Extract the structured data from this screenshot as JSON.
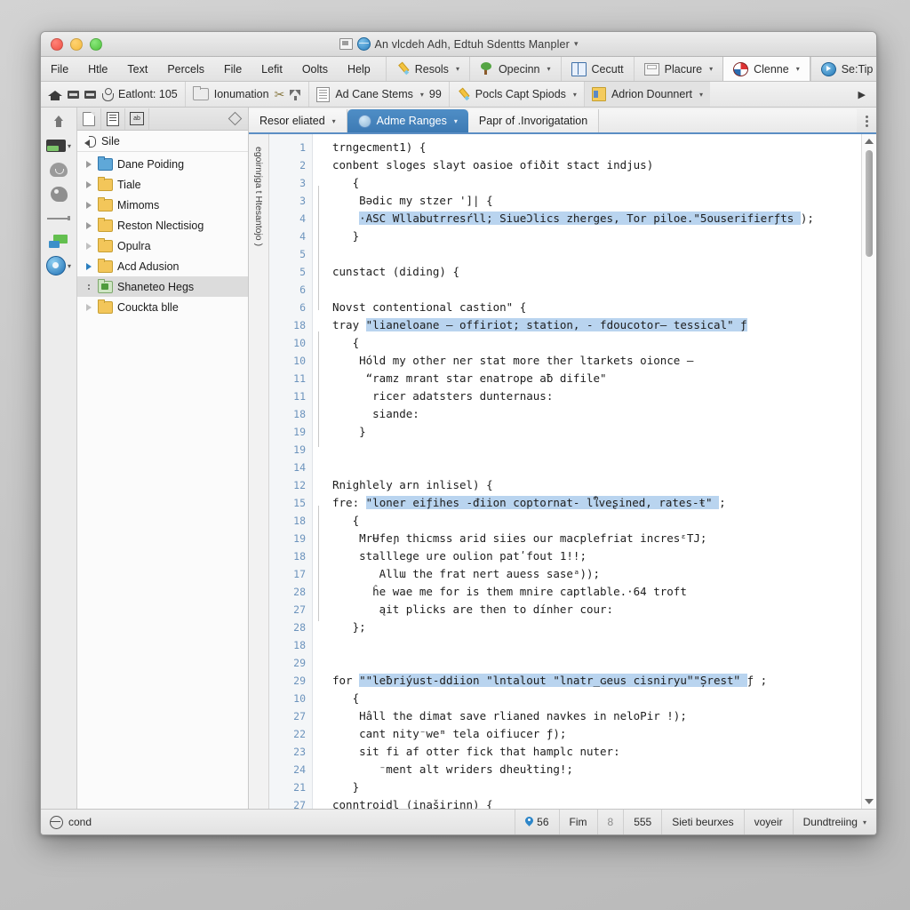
{
  "window": {
    "title": "An vlcdeh Adh, Edtuh Sdentts Manpler",
    "title_caret": "▾",
    "traffic": {
      "close": "close-button",
      "minimize": "minimize-button",
      "zoom": "zoom-button"
    }
  },
  "menubar": {
    "items": [
      {
        "label": "File"
      },
      {
        "label": "Htle"
      },
      {
        "label": "Text"
      },
      {
        "label": "Percels"
      },
      {
        "label": "File"
      },
      {
        "label": "Lefit"
      },
      {
        "label": "Oolts"
      },
      {
        "label": "Help"
      }
    ],
    "ribbon": [
      {
        "label": "Resols",
        "icon": "pencil-icon",
        "caret": "▾",
        "active": false
      },
      {
        "label": "Opecinn",
        "icon": "tree-icon",
        "caret": "▾",
        "active": false
      },
      {
        "label": "Cecutt",
        "icon": "book-icon",
        "caret": "",
        "active": false
      },
      {
        "label": "Placure",
        "icon": "frame-icon",
        "caret": "▾",
        "active": false
      },
      {
        "label": "Clenne",
        "icon": "target-icon",
        "caret": "▾",
        "active": true
      },
      {
        "label": "Se:Tip",
        "icon": "play-icon",
        "caret": "",
        "active": false
      }
    ]
  },
  "toolbar": {
    "home_label": "",
    "entry_label": "Eatlont: 105",
    "folder_label": "Ionumation",
    "doc_label": "Ad Cane Stems",
    "doc_caret": "▾",
    "doc_count": "99",
    "tools_label": "Pocls Capt Spiods",
    "tools_caret": "▾",
    "addon_label": "Adrion Dounnert",
    "addon_caret": "▾",
    "overflow": "▶"
  },
  "sidebar": {
    "header_label": "Sile",
    "toolbar_icons": [
      "document-icon",
      "list-icon",
      "ab-icon",
      "diamond-icon"
    ],
    "items": [
      {
        "label": "Dane Poiding",
        "folder": "blue",
        "tri": "normal"
      },
      {
        "label": "Tiale",
        "folder": "yellow",
        "tri": "normal"
      },
      {
        "label": "Mimoms",
        "folder": "yellow",
        "tri": "normal"
      },
      {
        "label": "Reston Nlectisiog",
        "folder": "yellow",
        "tri": "normal"
      },
      {
        "label": "Opulra",
        "folder": "yellow",
        "tri": "dim"
      },
      {
        "label": "Acd Adusion",
        "folder": "yellow",
        "tri": "blue"
      },
      {
        "label": "Shaneteo Hegs",
        "folder": "green",
        "tri": "dots",
        "selected": true
      },
      {
        "label": "Couckta blle",
        "folder": "yellow",
        "tri": "dim"
      }
    ]
  },
  "editor": {
    "tabs": [
      {
        "label": "Resor eliated",
        "caret": "▾",
        "active": false,
        "icon": "none"
      },
      {
        "label": "Adme Ranges",
        "caret": "▾",
        "active": true,
        "icon": "globe-icon"
      },
      {
        "label": "Papr of .Invorigatation",
        "caret": "",
        "active": false,
        "icon": "none"
      }
    ],
    "vertical_rail_label": "egoirnrjga t Htesantojo )",
    "line_numbers": [
      "1",
      "2",
      "3",
      "3",
      "4",
      "4",
      "5",
      "5",
      "6",
      "6",
      "18",
      "10",
      "10",
      "11",
      "11",
      "18",
      "19",
      "19",
      "14",
      "12",
      "15",
      "18",
      "19",
      "18",
      "17",
      "28",
      "27",
      "28",
      "18",
      "29",
      "29",
      "10",
      "27",
      "22",
      "23",
      "24",
      "21",
      "27"
    ],
    "lines": [
      {
        "text": "trngecment1) {",
        "sel": null
      },
      {
        "text": "conbent sloges slayt oasioe ofiðit stact indjus)",
        "sel": null
      },
      {
        "text": "   {",
        "sel": null
      },
      {
        "text": "    Bǝdic my stzer ']| {",
        "sel": null
      },
      {
        "text": "    ·ASC Wllabutrresŕll; SiueƆlics zherges, Tor piloe.\"5ouserifierƒts );",
        "sel": [
          4,
          70
        ]
      },
      {
        "text": "   }",
        "sel": null
      },
      {
        "text": "",
        "sel": null
      },
      {
        "text": "cunstact (diding) {",
        "sel": null
      },
      {
        "text": "",
        "sel": null
      },
      {
        "text": "Novst contentional castion\" {",
        "sel": null
      },
      {
        "text": "tray \"lianeloane — offiriot; station, - fdoucotor— tessical\" ƒ",
        "sel": [
          5,
          62
        ]
      },
      {
        "text": "   {",
        "sel": null
      },
      {
        "text": "    Hóld my other ner stat more ther ltarkets oionce —",
        "sel": null
      },
      {
        "text": "     “ramz mrant star enatrope aƀ difile\"",
        "sel": null
      },
      {
        "text": "      ricer adatsters dunternaus:",
        "sel": null
      },
      {
        "text": "      siande:",
        "sel": null
      },
      {
        "text": "    }",
        "sel": null
      },
      {
        "text": "",
        "sel": null
      },
      {
        "text": "",
        "sel": null
      },
      {
        "text": "Rnighlely arn inlisel) {",
        "sel": null
      },
      {
        "text": "fre: \"loner eiƒihes -điion coptornat- lใveʂined, rates-ŧ\" ;",
        "sel": [
          5,
          58
        ]
      },
      {
        "text": "   {",
        "sel": null
      },
      {
        "text": "    MrɄfeɲ thicmss arid siies our macplefriat incresᵋTJ;",
        "sel": null
      },
      {
        "text": "    stalllege ure oulion patʹfout 1!!;",
        "sel": null
      },
      {
        "text": "       Allɯ the frat nert auess saseᵃ));",
        "sel": null
      },
      {
        "text": "      ĥe wae me for is them mnire captlable.·64 troft",
        "sel": null
      },
      {
        "text": "       ąit plicks are then to dínher cour:",
        "sel": null
      },
      {
        "text": "   };",
        "sel": null
      },
      {
        "text": "",
        "sel": null
      },
      {
        "text": "",
        "sel": null
      },
      {
        "text": "for \"\"leƀriýust-ddiion \"lntalout \"lnatr_ɢeus cisniryuʺ\"Șrestʺ ƒ ;",
        "sel": [
          4,
          62
        ]
      },
      {
        "text": "   {",
        "sel": null
      },
      {
        "text": "    Hâll the dimat save rlianed navkes in neloPir !);",
        "sel": null
      },
      {
        "text": "    cant nity⁻weᵐ tela oifiucer ƒ);",
        "sel": null
      },
      {
        "text": "    sit fi af otter fick that hamplc nuter:",
        "sel": null
      },
      {
        "text": "       ⁻ment alt wriders dheułting!;",
        "sel": null
      },
      {
        "text": "   }",
        "sel": null
      },
      {
        "text": "conntroidl (inaširinn) {",
        "sel": null
      }
    ]
  },
  "statusbar": {
    "left_label": "cond",
    "cells": [
      {
        "label": "56",
        "icon": "pin-icon"
      },
      {
        "label": "Fim",
        "icon": "none"
      },
      {
        "label": "8",
        "icon": "none",
        "dim": true
      },
      {
        "label": "555",
        "icon": "none"
      },
      {
        "label": "Sieti beurxes",
        "icon": "none"
      },
      {
        "label": "voyeir",
        "icon": "none"
      },
      {
        "label": "Dundtreiing",
        "icon": "none",
        "caret": "▾"
      }
    ]
  },
  "colors": {
    "accent_blue": "#3d7ab4",
    "selection_blue": "#b9d4ef",
    "folder_yellow": "#f3c65a",
    "gutter_text": "#6d94bd",
    "window_chrome": "#ececec"
  }
}
